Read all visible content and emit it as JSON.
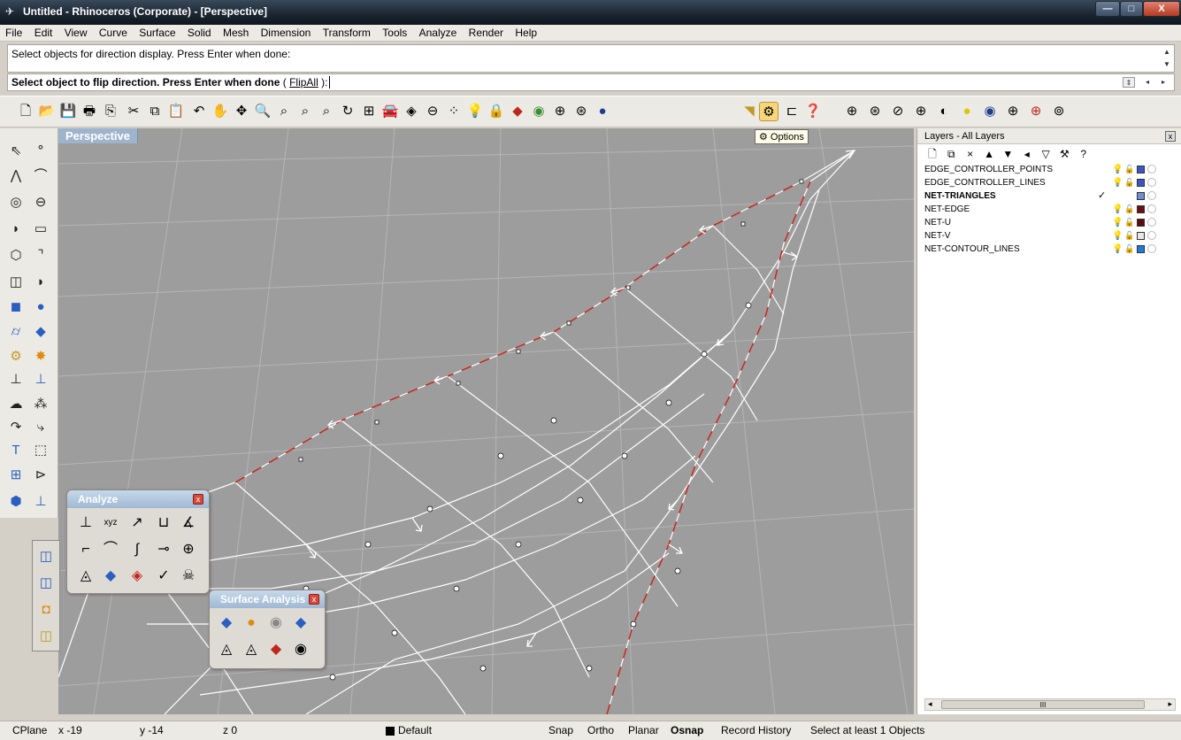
{
  "window": {
    "title": "Untitled - Rhinoceros (Corporate) - [Perspective]",
    "min_label": "—",
    "max_label": "□",
    "close_label": "X"
  },
  "menu": [
    "File",
    "Edit",
    "View",
    "Curve",
    "Surface",
    "Solid",
    "Mesh",
    "Dimension",
    "Transform",
    "Tools",
    "Analyze",
    "Render",
    "Help"
  ],
  "command": {
    "history": "Select objects for direction display. Press Enter when done:",
    "prompt": "Select object to flip direction. Press Enter when done",
    "option_open": " ( ",
    "option": "FlipAll",
    "option_close": " ):"
  },
  "toolbar_icons": [
    "new-icon",
    "open-icon",
    "save-icon",
    "print-icon",
    "import-icon",
    "cut-icon",
    "copy-icon",
    "paste-icon",
    "undo-icon",
    "pan-icon",
    "rotate-icon",
    "zoom-icon",
    "zoom-window-icon",
    "zoom-extents-icon",
    "zoom-selected-icon",
    "view-rotate-icon",
    "four-views-icon",
    "car-icon",
    "texture-icon",
    "circle-arrow-icon",
    "points-icon",
    "lightbulb-icon",
    "lock-icon",
    "layer-icon",
    "color-wheel-icon",
    "sphere-wire-icon",
    "sphere-shade-icon",
    "sphere-render-icon",
    "light-icon",
    "options-icon",
    "properties-icon",
    "help-icon"
  ],
  "viewport": {
    "name": "Perspective",
    "tooltip": "Options"
  },
  "analyze_panel": {
    "title": "Analyze",
    "close": "x"
  },
  "surface_analysis_panel": {
    "title": "Surface Analysis",
    "close": "x"
  },
  "layers": {
    "title": "Layers - All Layers",
    "close": "x",
    "tools": [
      "🗋",
      "⧉",
      "×",
      "▲",
      "▼",
      "◂",
      "▽",
      "⚒",
      "?"
    ],
    "rows": [
      {
        "name": "EDGE_CONTROLLER_POINTS",
        "color": "#3b55c9",
        "current": false
      },
      {
        "name": "EDGE_CONTROLLER_LINES",
        "color": "#3b55c9",
        "current": false
      },
      {
        "name": "NET-TRIANGLES",
        "color": "#6f8fd6",
        "current": true
      },
      {
        "name": "NET-EDGE",
        "color": "#6b0f0f",
        "current": false
      },
      {
        "name": "NET-U",
        "color": "#5a0b0b",
        "current": false
      },
      {
        "name": "NET-V",
        "color": "#e8e8e8",
        "current": false
      },
      {
        "name": "NET-CONTOUR_LINES",
        "color": "#1f7bd9",
        "current": false
      }
    ],
    "current_mark": "✓",
    "scroll_label": "III"
  },
  "status": {
    "cplane": "CPlane",
    "x": "x -19",
    "y": "y -14",
    "z": "z 0",
    "layer": "Default",
    "snap": "Snap",
    "ortho": "Ortho",
    "planar": "Planar",
    "osnap": "Osnap",
    "record": "Record History",
    "message": "Select at least 1 Objects"
  }
}
